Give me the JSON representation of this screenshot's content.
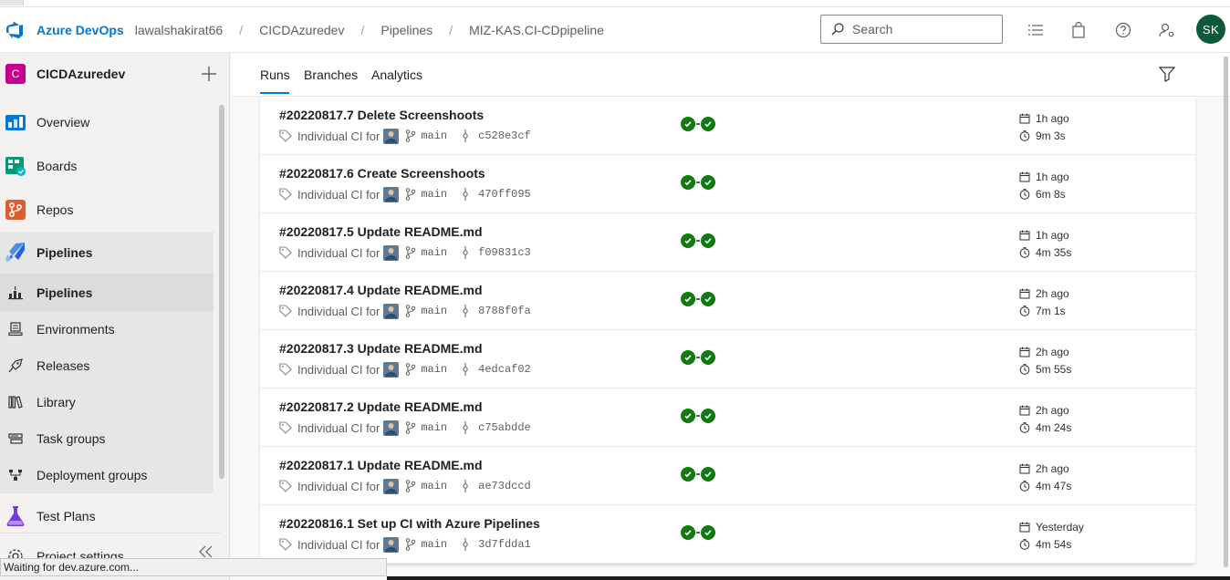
{
  "header": {
    "brand": "Azure DevOps",
    "breadcrumbs": [
      "lawalshakirat66",
      "CICDAzuredev",
      "Pipelines",
      "MIZ-KAS.CI-CDpipeline"
    ],
    "search_placeholder": "Search",
    "avatar_initials": "SK",
    "avatar_color": "#0b5a3a"
  },
  "sidebar": {
    "project_initial": "C",
    "project_name": "CICDAzuredev",
    "project_color": "#c4008c",
    "items": [
      {
        "label": "Overview",
        "icon": "overview-icon"
      },
      {
        "label": "Boards",
        "icon": "boards-icon"
      },
      {
        "label": "Repos",
        "icon": "repos-icon"
      },
      {
        "label": "Pipelines",
        "icon": "pipelines-icon"
      },
      {
        "label": "Pipelines",
        "icon": "pipelines-sub-icon"
      },
      {
        "label": "Environments",
        "icon": "environments-icon"
      },
      {
        "label": "Releases",
        "icon": "releases-icon"
      },
      {
        "label": "Library",
        "icon": "library-icon"
      },
      {
        "label": "Task groups",
        "icon": "task-groups-icon"
      },
      {
        "label": "Deployment groups",
        "icon": "deployment-groups-icon"
      },
      {
        "label": "Test Plans",
        "icon": "test-plans-icon"
      },
      {
        "label": "Project settings",
        "icon": "settings-icon"
      }
    ]
  },
  "tabs": [
    "Runs",
    "Branches",
    "Analytics"
  ],
  "runs": [
    {
      "title": "#20220817.7 Delete Screenshoots",
      "trigger": "Individual CI for",
      "branch": "main",
      "commit": "c528e3cf",
      "when": "1h ago",
      "duration": "9m 3s"
    },
    {
      "title": "#20220817.6 Create Screenshoots",
      "trigger": "Individual CI for",
      "branch": "main",
      "commit": "470ff095",
      "when": "1h ago",
      "duration": "6m 8s"
    },
    {
      "title": "#20220817.5 Update README.md",
      "trigger": "Individual CI for",
      "branch": "main",
      "commit": "f09831c3",
      "when": "1h ago",
      "duration": "4m 35s"
    },
    {
      "title": "#20220817.4 Update README.md",
      "trigger": "Individual CI for",
      "branch": "main",
      "commit": "8788f0fa",
      "when": "2h ago",
      "duration": "7m 1s"
    },
    {
      "title": "#20220817.3 Update README.md",
      "trigger": "Individual CI for",
      "branch": "main",
      "commit": "4edcaf02",
      "when": "2h ago",
      "duration": "5m 55s"
    },
    {
      "title": "#20220817.2 Update README.md",
      "trigger": "Individual CI for",
      "branch": "main",
      "commit": "c75abdde",
      "when": "2h ago",
      "duration": "4m 24s"
    },
    {
      "title": "#20220817.1 Update README.md",
      "trigger": "Individual CI for",
      "branch": "main",
      "commit": "ae73dccd",
      "when": "2h ago",
      "duration": "4m 47s"
    },
    {
      "title": "#20220816.1 Set up CI with Azure Pipelines",
      "trigger": "Individual CI for",
      "branch": "main",
      "commit": "3d7fdda1",
      "when": "Yesterday",
      "duration": "4m 54s"
    }
  ],
  "status_text": "Waiting for dev.azure.com...",
  "colors": {
    "accent": "#0078d4",
    "success": "#107c10"
  }
}
